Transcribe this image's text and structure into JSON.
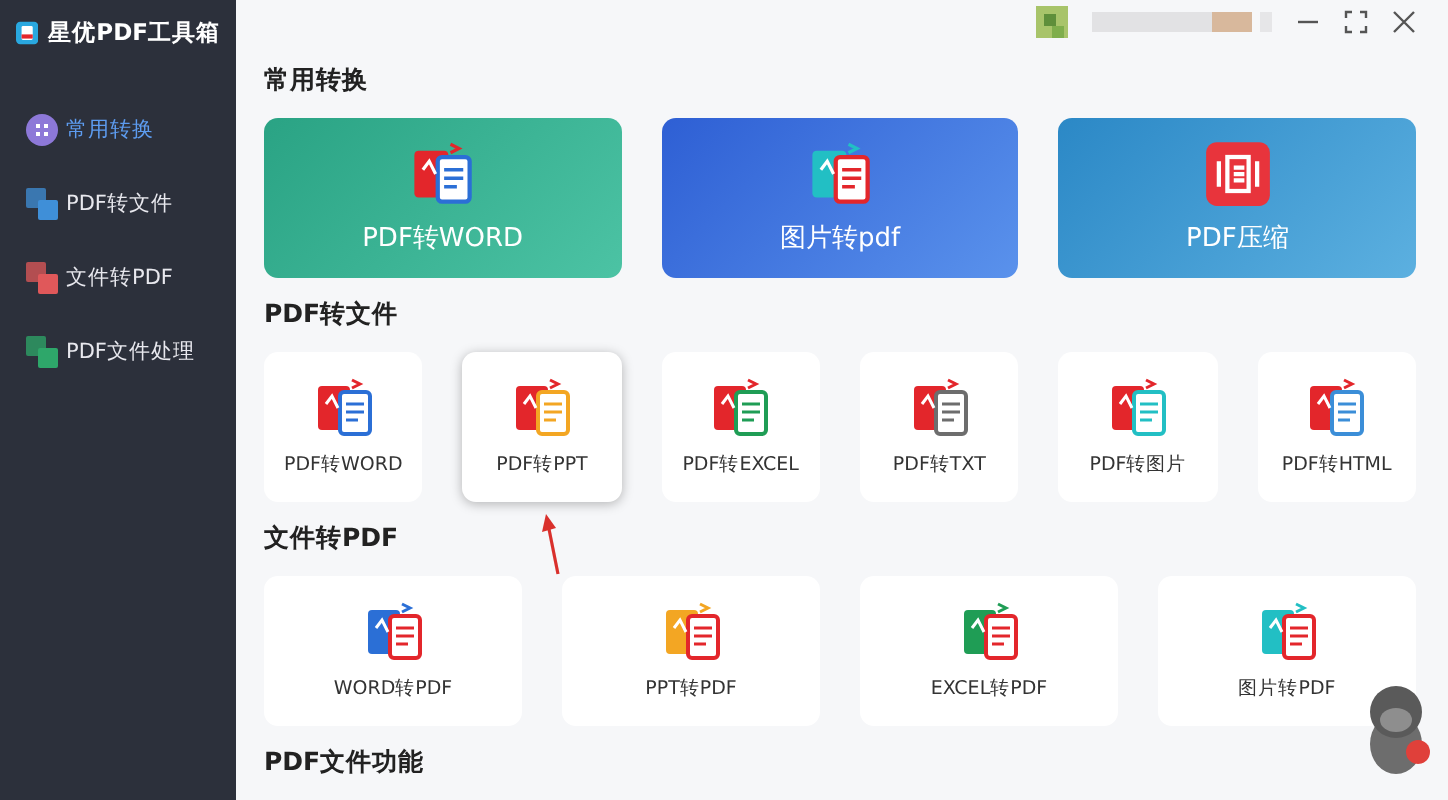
{
  "app": {
    "title": "星优PDF工具箱"
  },
  "sidebar": {
    "items": [
      {
        "label": "常用转换",
        "selected": true
      },
      {
        "label": "PDF转文件",
        "selected": false
      },
      {
        "label": "文件转PDF",
        "selected": false
      },
      {
        "label": "PDF文件处理",
        "selected": false
      }
    ]
  },
  "sections": [
    {
      "title": "常用转换",
      "cards": [
        {
          "label": "PDF转WORD",
          "selected": false
        },
        {
          "label": "图片转pdf",
          "selected": false
        },
        {
          "label": "PDF压缩",
          "selected": false
        }
      ]
    },
    {
      "title": "PDF转文件",
      "cards": [
        {
          "label": "PDF转WORD",
          "selected": false
        },
        {
          "label": "PDF转PPT",
          "selected": true
        },
        {
          "label": "PDF转EXCEL",
          "selected": false
        },
        {
          "label": "PDF转TXT",
          "selected": false
        },
        {
          "label": "PDF转图片",
          "selected": false
        },
        {
          "label": "PDF转HTML",
          "selected": false
        }
      ]
    },
    {
      "title": "文件转PDF",
      "cards": [
        {
          "label": "WORD转PDF",
          "selected": false
        },
        {
          "label": "PPT转PDF",
          "selected": false
        },
        {
          "label": "EXCEL转PDF",
          "selected": false
        },
        {
          "label": "图片转PDF",
          "selected": false
        }
      ]
    },
    {
      "title": "PDF文件功能"
    }
  ]
}
